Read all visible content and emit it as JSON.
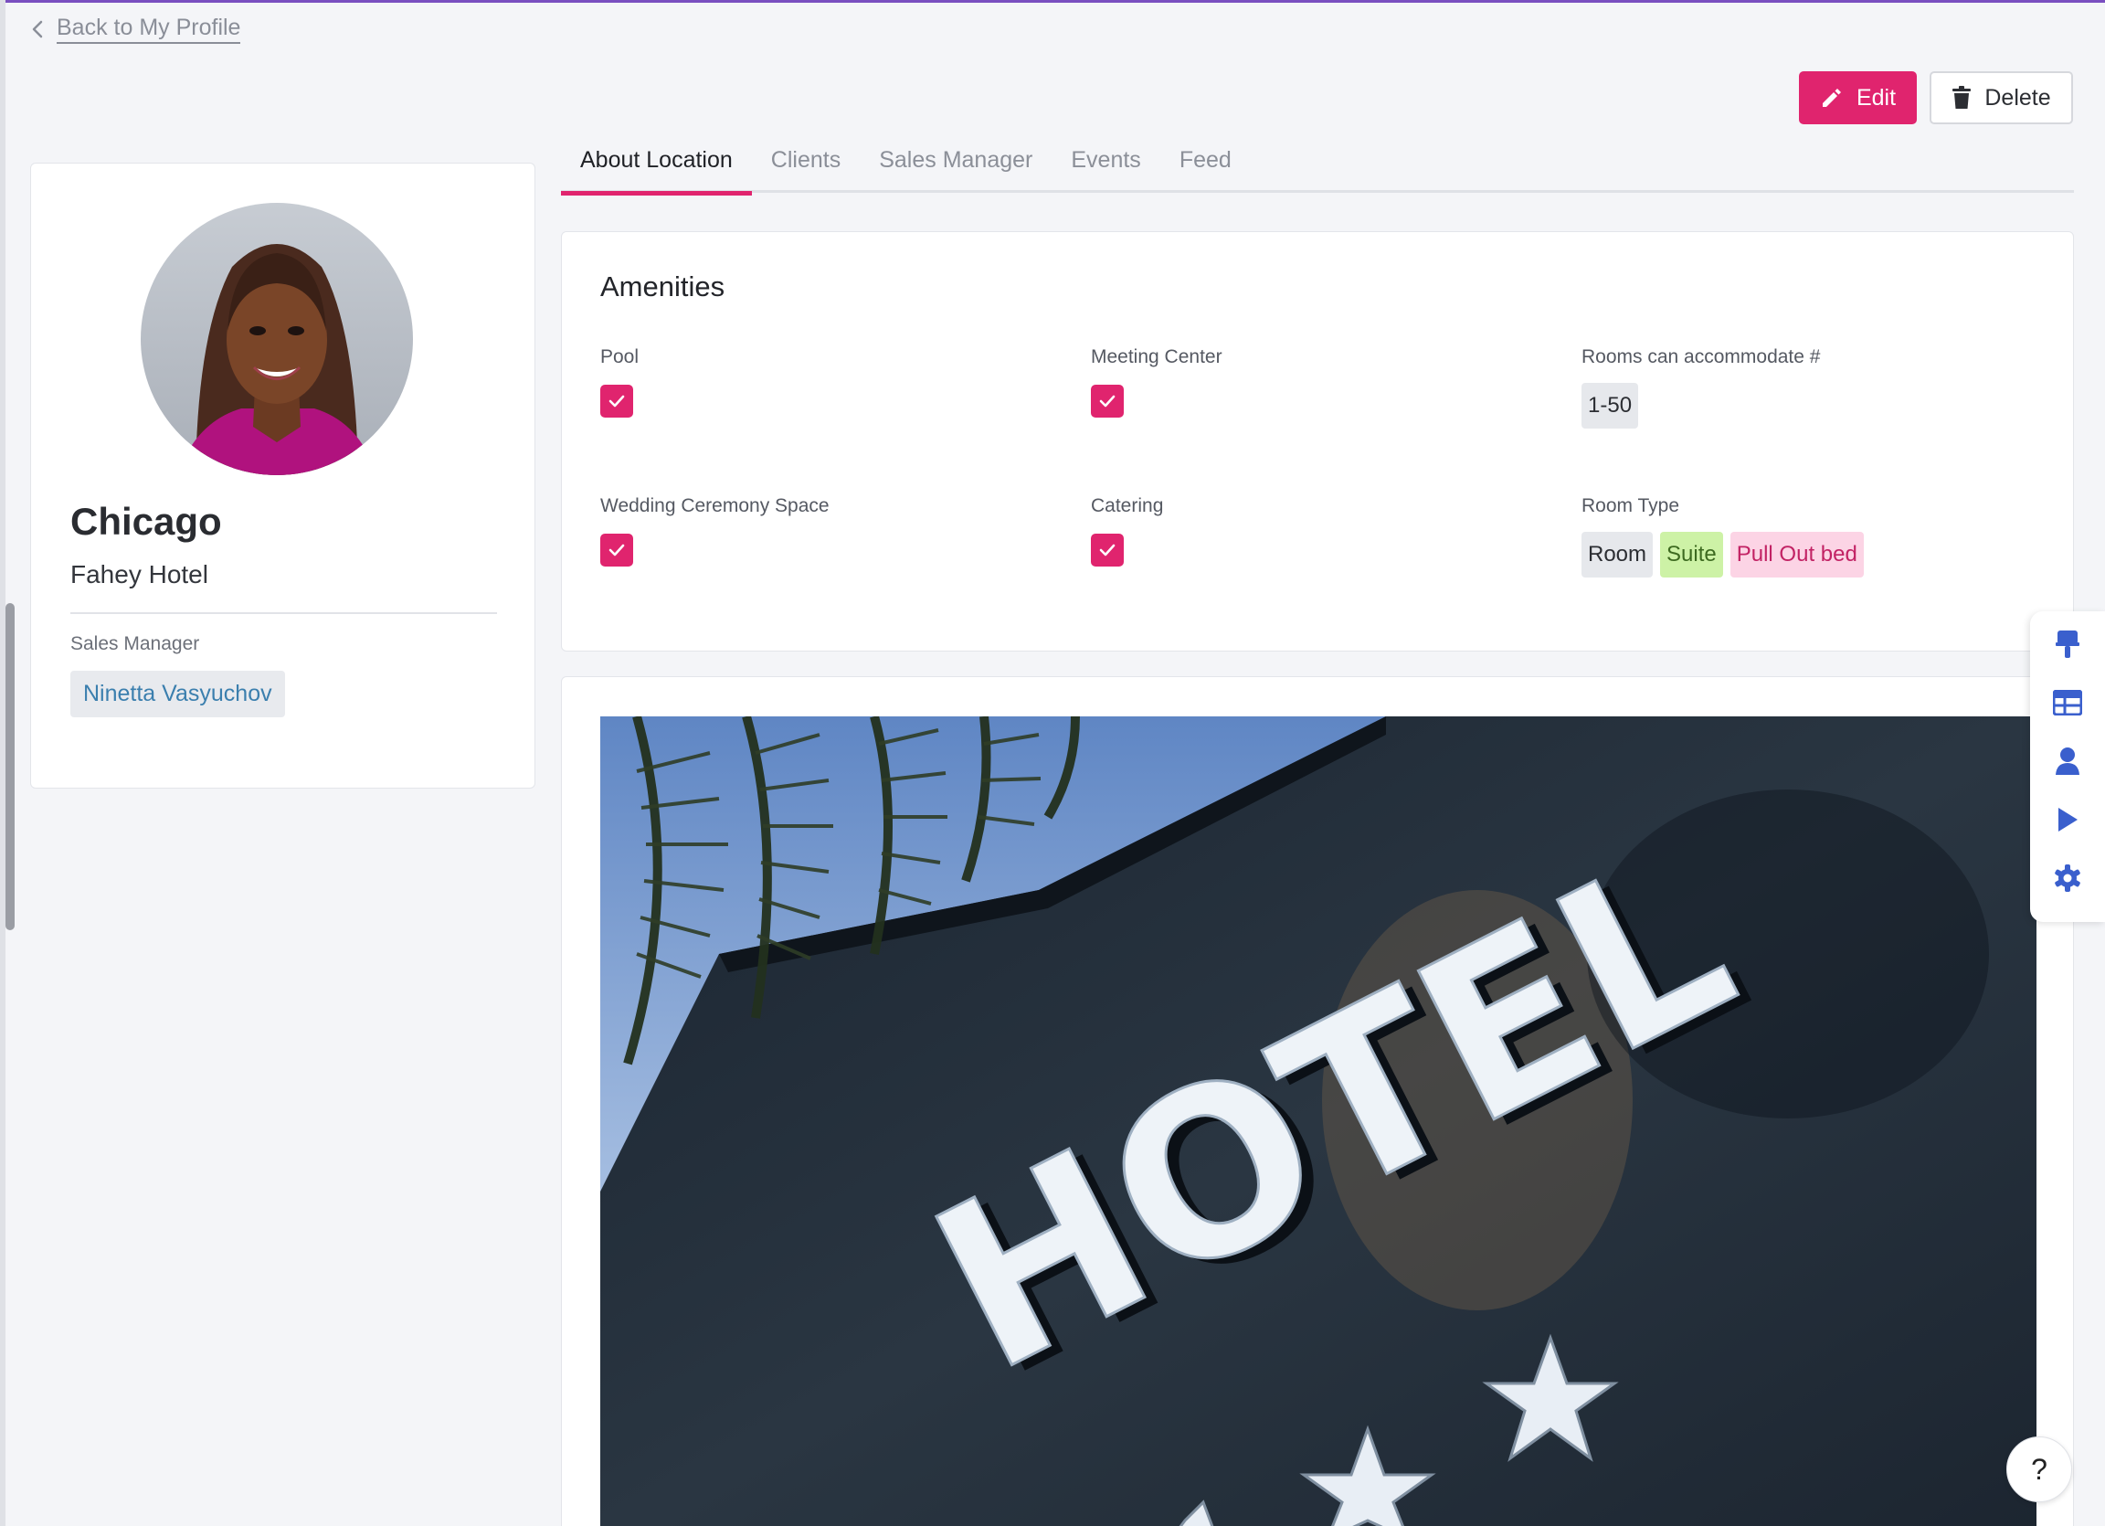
{
  "nav": {
    "back_label": "Back to My Profile"
  },
  "actions": {
    "edit_label": "Edit",
    "delete_label": "Delete"
  },
  "profile": {
    "city": "Chicago",
    "hotel_name": "Fahey Hotel",
    "sales_manager_label": "Sales Manager",
    "sales_manager_name": "Ninetta Vasyuchov"
  },
  "tabs": [
    {
      "label": "About Location",
      "active": true
    },
    {
      "label": "Clients",
      "active": false
    },
    {
      "label": "Sales Manager",
      "active": false
    },
    {
      "label": "Events",
      "active": false
    },
    {
      "label": "Feed",
      "active": false
    }
  ],
  "amenities": {
    "title": "Amenities",
    "pool": {
      "label": "Pool",
      "checked": true
    },
    "meeting_center": {
      "label": "Meeting Center",
      "checked": true
    },
    "rooms_accommodate": {
      "label": "Rooms can accommodate #",
      "value": "1-50"
    },
    "wedding_space": {
      "label": "Wedding Ceremony Space",
      "checked": true
    },
    "catering": {
      "label": "Catering",
      "checked": true
    },
    "room_type": {
      "label": "Room Type",
      "values": [
        "Room",
        "Suite",
        "Pull Out bed"
      ]
    }
  },
  "photo": {
    "sign_text": "HOTEL"
  },
  "toolbar": {
    "icons": [
      "brush-icon",
      "table-icon",
      "person-icon",
      "play-icon",
      "gear-icon"
    ]
  },
  "help": {
    "label": "?"
  },
  "colors": {
    "accent": "#e0246e",
    "toolbar_icon": "#3a5fcd",
    "link": "#3b7fae"
  }
}
